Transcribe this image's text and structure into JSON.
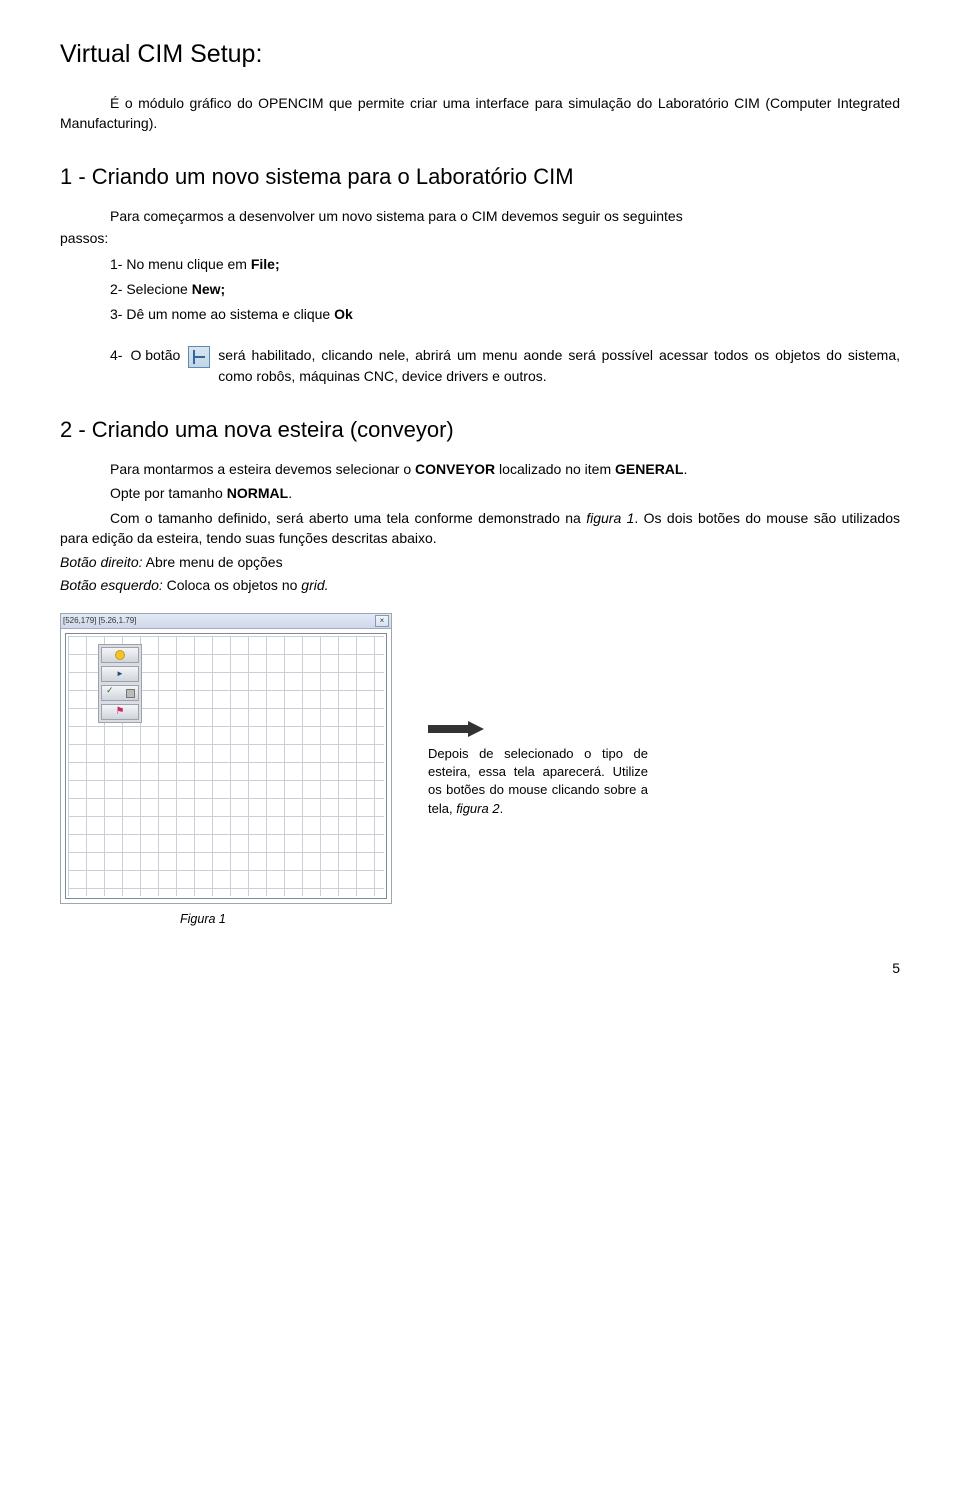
{
  "title": "Virtual CIM Setup:",
  "intro": "É o módulo gráfico do OPENCIM que permite criar uma interface para simulação do Laboratório CIM (Computer Integrated Manufacturing).",
  "sec1": {
    "heading": "1 -  Criando um novo sistema  para o Laboratório CIM",
    "lead": "Para começarmos a desenvolver um novo sistema para o CIM devemos seguir os seguintes",
    "passos": "passos:",
    "step1_pre": "1-  No menu clique em ",
    "step1_bold": "File;",
    "step2_pre": "2-  Selecione ",
    "step2_bold": "New;",
    "step3_pre": "3-  Dê um nome ao sistema e clique ",
    "step3_bold": "Ok",
    "step4_num": "4-",
    "step4_pre": "O botão",
    "step4_post": "  será habilitado, clicando nele, abrirá um menu aonde será possível acessar todos os objetos do sistema, como robôs, máquinas CNC, device drivers e outros."
  },
  "sec2": {
    "heading": "2 - Criando uma nova esteira (conveyor)",
    "p1_pre": "Para montarmos a esteira devemos selecionar o ",
    "p1_b1": "CONVEYOR",
    "p1_mid": " localizado no item ",
    "p1_b2": "GENERAL",
    "p1_post": ".",
    "p2_pre": "Opte por tamanho ",
    "p2_b": "NORMAL",
    "p2_post": ".",
    "p3_pre": "Com o tamanho definido, será aberto uma tela conforme demonstrado na ",
    "p3_i": "figura 1",
    "p3_post": ". Os dois botões do mouse são utilizados para edição da esteira, tendo suas funções descritas abaixo.",
    "p4_i": "Botão direito:",
    "p4_post": " Abre menu de opções",
    "p5_i": "Botão esquerdo:",
    "p5_post": " Coloca os objetos no ",
    "p5_i2": "grid."
  },
  "figure": {
    "titlebar": "[526,179] [5.26,1.79]",
    "close": "×",
    "caption_pre": "Depois de selecionado o tipo de esteira, essa tela aparecerá. Utilize os botões do mouse clicando sobre a tela, ",
    "caption_i": "figura 2",
    "caption_post": ".",
    "label": "Figura 1"
  },
  "page_number": "5"
}
